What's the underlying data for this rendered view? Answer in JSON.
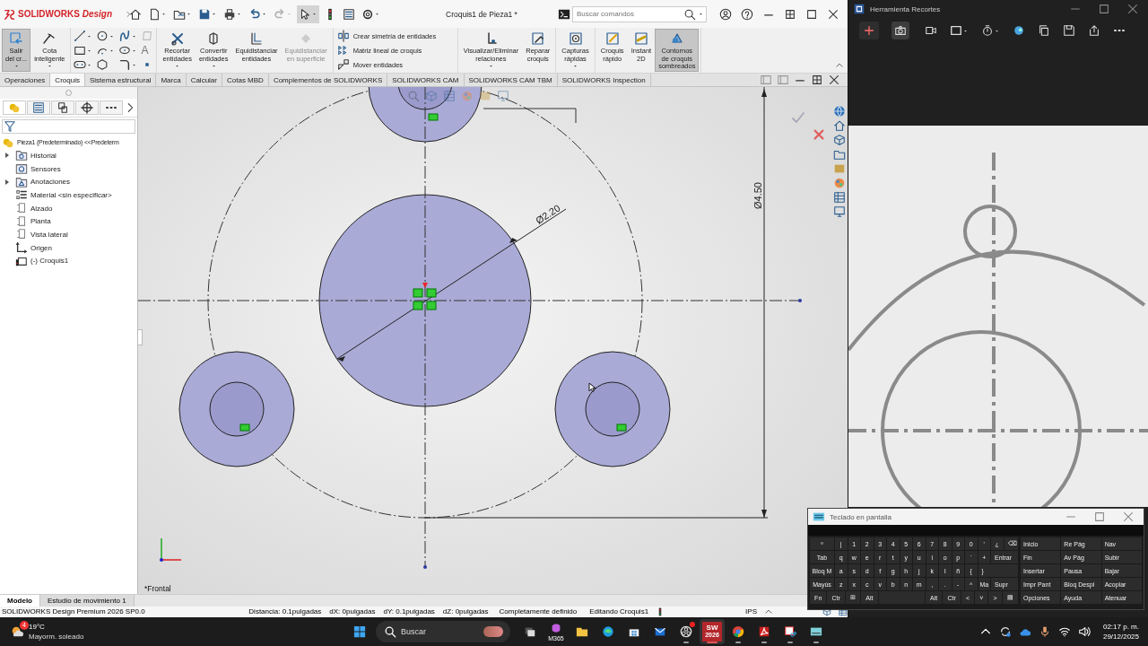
{
  "window": {
    "logo": "**SOLID**WORKS *Design*",
    "title": "Croquis1 de Pieza1 *"
  },
  "quick_access": [
    {
      "kind": "home",
      "disabled": false,
      "pressed": false
    },
    {
      "kind": "file",
      "disabled": false,
      "pressed": false
    },
    {
      "kind": "folder",
      "disabled": false,
      "pressed": false
    },
    {
      "kind": "save",
      "disabled": false,
      "pressed": false
    },
    {
      "kind": "print",
      "disabled": false,
      "pressed": false
    },
    {
      "kind": "undo",
      "disabled": false,
      "pressed": false
    },
    {
      "kind": "redo",
      "disabled": true,
      "pressed": false
    },
    {
      "kind": "cursor",
      "disabled": false,
      "pressed": true
    },
    {
      "kind": "traffic",
      "disabled": false,
      "pressed": false
    },
    {
      "kind": "list",
      "disabled": false,
      "pressed": false
    },
    {
      "kind": "gear",
      "disabled": false,
      "pressed": false
    }
  ],
  "search": {
    "placeholder": "Buscar comandos"
  },
  "ribbon": {
    "sections": [
      {
        "kind": "big",
        "buttons": [
          {
            "label": "Salir\ndel cr...",
            "selected": true,
            "disabled": false,
            "menu": true
          },
          {
            "label": "Cota\ninteligente",
            "selected": false,
            "disabled": false,
            "menu": true
          }
        ]
      },
      {
        "kind": "grid",
        "glyph": "A"
      },
      {
        "kind": "big",
        "buttons": [
          {
            "label": "Recortar\nentidades",
            "selected": false,
            "disabled": false,
            "menu": true
          },
          {
            "label": "Convertir\nentidades",
            "selected": false,
            "disabled": false,
            "menu": true
          },
          {
            "label": "Equidistanciar\nentidades",
            "selected": false,
            "disabled": false,
            "menu": false
          },
          {
            "label": "Equidistanciar\nen superficie",
            "selected": false,
            "disabled": true,
            "menu": false
          }
        ]
      },
      {
        "kind": "list",
        "items": [
          "Crear simetría de entidades",
          "Matriz lineal de croquis",
          "Mover entidades"
        ]
      },
      {
        "kind": "big",
        "buttons": [
          {
            "label": "Visualizar/Eliminar\nrelaciones",
            "selected": false,
            "disabled": false,
            "menu": true
          },
          {
            "label": "Reparar\ncroquis",
            "selected": false,
            "disabled": false,
            "menu": false
          }
        ]
      },
      {
        "kind": "big",
        "buttons": [
          {
            "label": "Capturas\nrápidas",
            "selected": false,
            "disabled": false,
            "menu": true
          }
        ]
      },
      {
        "kind": "big",
        "buttons": [
          {
            "label": "Croquis\nrápido",
            "selected": false,
            "disabled": false,
            "menu": false
          },
          {
            "label": "Instant\n2D",
            "selected": false,
            "disabled": false,
            "menu": false
          },
          {
            "label": "Contornos\nde croquis\nsombreados",
            "selected": true,
            "disabled": false,
            "menu": false
          }
        ]
      }
    ]
  },
  "command_tabs": [
    {
      "label": "Operaciones",
      "selected": false
    },
    {
      "label": "Croquis",
      "selected": true
    },
    {
      "label": "Sistema estructural",
      "selected": false
    },
    {
      "label": "Marca",
      "selected": false
    },
    {
      "label": "Calcular",
      "selected": false
    },
    {
      "label": "Cotas MBD",
      "selected": false
    },
    {
      "label": "Complementos de SOLIDWORKS",
      "selected": false
    },
    {
      "label": "SOLIDWORKS CAM",
      "selected": false
    },
    {
      "label": "SOLIDWORKS CAM TBM",
      "selected": false
    },
    {
      "label": "SOLIDWORKS Inspection",
      "selected": false
    }
  ],
  "tree": {
    "root": "Pieza1 (Predeterminado) <<Predeterm",
    "children": [
      {
        "kind": "folder",
        "label": "Historial",
        "expandable": true
      },
      {
        "kind": "sensor",
        "label": "Sensores",
        "expandable": false
      },
      {
        "kind": "annotations",
        "label": "Anotaciones",
        "expandable": true
      },
      {
        "kind": "material",
        "label": "Material <sin especificar>",
        "expandable": false
      },
      {
        "kind": "plane",
        "label": "Alzado",
        "expandable": false
      },
      {
        "kind": "plane",
        "label": "Planta",
        "expandable": false
      },
      {
        "kind": "plane",
        "label": "Vista lateral",
        "expandable": false
      },
      {
        "kind": "origin",
        "label": "Origen",
        "expandable": false
      },
      {
        "kind": "sketch",
        "label": "(-) Croquis1",
        "expandable": false
      }
    ]
  },
  "dimensions": {
    "inner_diameter": "Ø2.20",
    "outer_diameter": "Ø4.50"
  },
  "view_label": "*Frontal",
  "bottom_tabs": [
    {
      "label": "Modelo",
      "selected": true
    },
    {
      "label": "Estudio de movimiento 1",
      "selected": false
    }
  ],
  "status_bar": {
    "product": "SOLIDWORKS Design Premium 2026 SP0.0",
    "measures": [
      "Distancia: 0.1pulgadas",
      "dX: 0pulgadas",
      "dY: 0.1pulgadas",
      "dZ: 0pulgadas"
    ],
    "sketch_state": "Completamente definido",
    "editing": "Editando Croquis1",
    "units": "IPS"
  },
  "snipping_tool": {
    "title": "Herramienta Recortes",
    "capture_modes": [
      {
        "selected": true
      },
      {
        "selected": false
      }
    ]
  },
  "keyboard": {
    "title": "Teclado en pantalla",
    "rows": [
      [
        "º",
        "|",
        "1",
        "2",
        "3",
        "4",
        "5",
        "6",
        "7",
        "8",
        "9",
        "0",
        "'",
        "¿",
        "⌫"
      ],
      [
        "Tab",
        "q",
        "w",
        "e",
        "r",
        "t",
        "y",
        "u",
        "i",
        "o",
        "p",
        "`",
        "+",
        "Entrar"
      ],
      [
        "Bloq M",
        "a",
        "s",
        "d",
        "f",
        "g",
        "h",
        "j",
        "k",
        "l",
        "ñ",
        "{",
        "}"
      ],
      [
        "Mayús",
        "z",
        "x",
        "c",
        "v",
        "b",
        "n",
        "m",
        ",",
        ".",
        "-",
        "^",
        "Ma",
        "Supr"
      ]
    ],
    "bottom_left": [
      "Fn",
      "Ctr",
      "⊞",
      "Alt"
    ],
    "bottom_right": [
      "Alt",
      "Ctr",
      "<",
      "˅",
      ">",
      "▤"
    ],
    "nav": [
      [
        "Inicio",
        "Re Pág",
        "Nav"
      ],
      [
        "Fin",
        "Av Pág",
        "Subir"
      ],
      [
        "Insertar",
        "Pausa",
        "Bajar"
      ],
      [
        "Impr Pant",
        "Bloq Despl",
        "Acoplar"
      ],
      [
        "Opciones",
        "Ayuda",
        "Atenuar"
      ]
    ]
  },
  "taskbar": {
    "weather": {
      "badge": "4",
      "temperature": "19°C",
      "condition": "Mayorm. soleado"
    },
    "search": {
      "placeholder": "Buscar"
    },
    "apps": [
      {
        "kind": "taskview",
        "running": false,
        "active": false,
        "notification": false
      },
      {
        "kind": "m365",
        "text": "M365",
        "running": false,
        "active": false,
        "notification": false
      },
      {
        "kind": "folder",
        "running": false,
        "active": false,
        "notification": false
      },
      {
        "kind": "edge",
        "running": false,
        "active": false,
        "notification": false
      },
      {
        "kind": "store",
        "running": false,
        "active": false,
        "notification": false
      },
      {
        "kind": "outlook",
        "running": false,
        "active": false,
        "notification": false
      },
      {
        "kind": "obs",
        "running": true,
        "active": false,
        "notification": true
      },
      {
        "kind": "sw",
        "text": "SW",
        "subtext": "2026",
        "running": true,
        "active": true,
        "notification": false
      },
      {
        "kind": "chrome",
        "running": true,
        "active": false,
        "notification": false
      },
      {
        "kind": "acrobat",
        "running": true,
        "active": false,
        "notification": false
      },
      {
        "kind": "snip",
        "running": true,
        "active": false,
        "notification": false
      },
      {
        "kind": "keyboard",
        "running": true,
        "active": false,
        "notification": false
      }
    ],
    "time": "02:17 p. m.",
    "date": "29/12/2025"
  }
}
